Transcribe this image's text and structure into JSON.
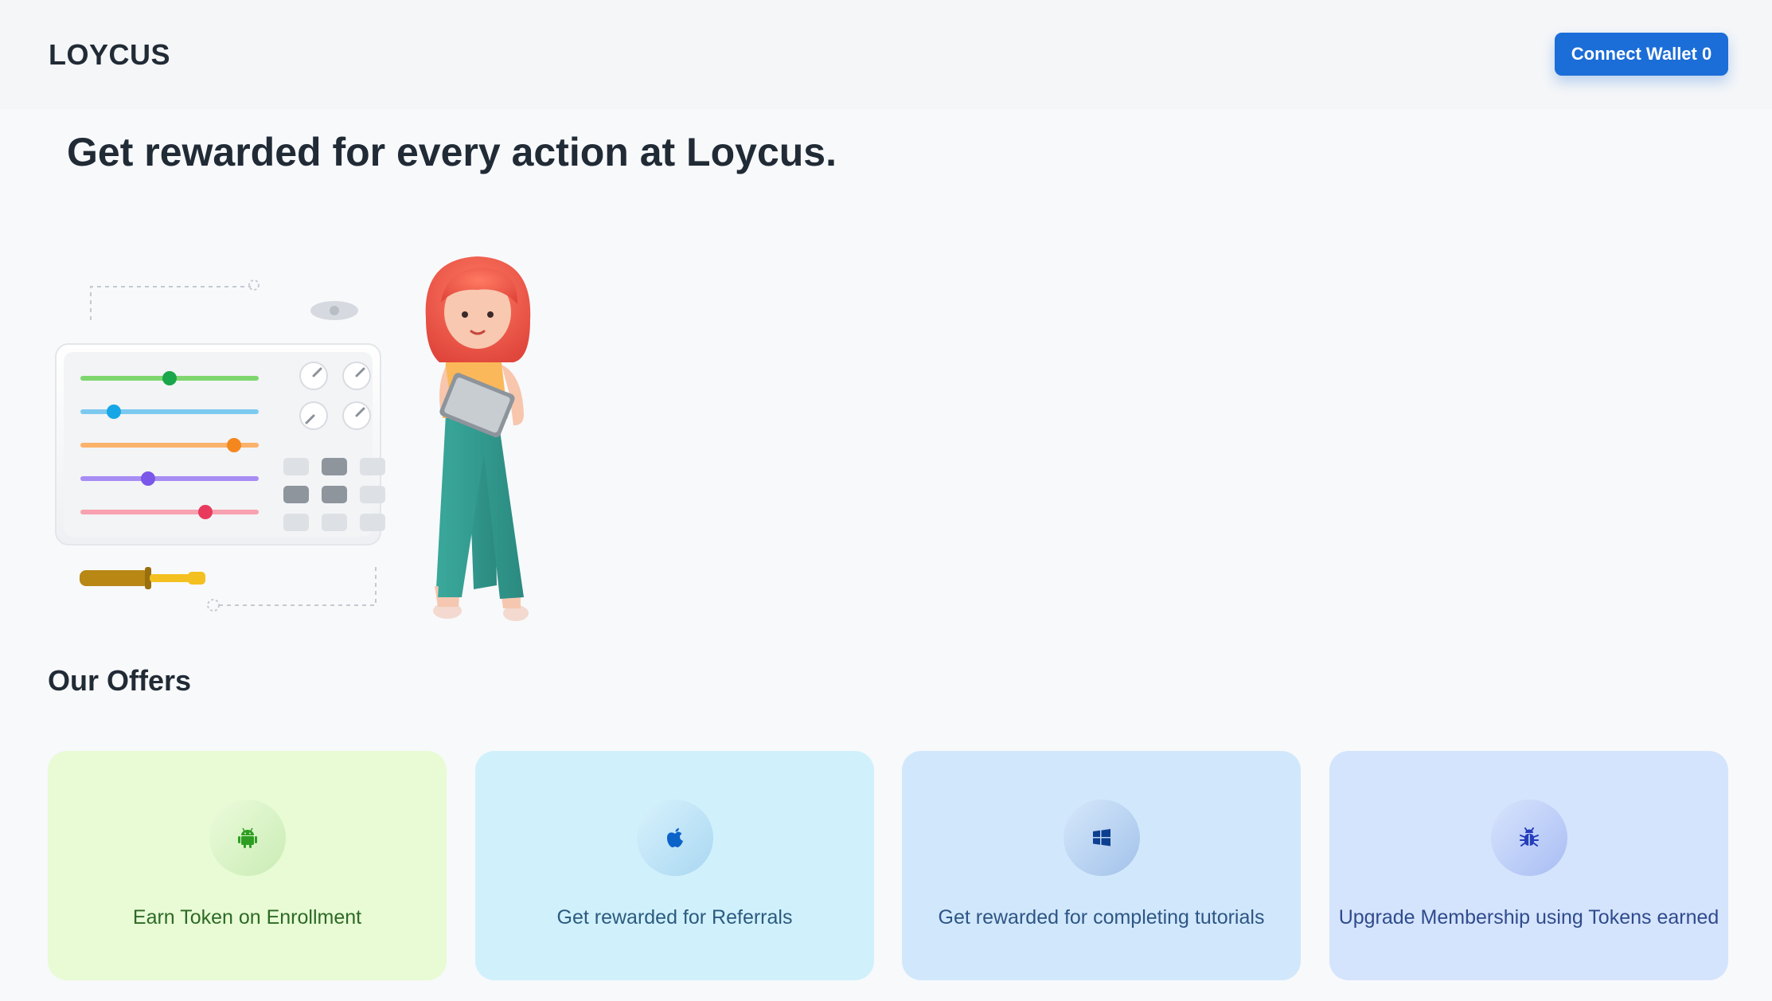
{
  "header": {
    "logo": "LOYCUS",
    "connect_button": "Connect Wallet 0"
  },
  "hero": {
    "title": "Get rewarded for every action at Loycus."
  },
  "offers": {
    "title": "Our Offers",
    "cards": [
      {
        "label": "Earn Token on Enrollment",
        "icon": "android-icon",
        "color": "#2e9e22"
      },
      {
        "label": "Get rewarded for Referrals",
        "icon": "apple-icon",
        "color": "#0b63c9"
      },
      {
        "label": "Get rewarded for completing tutorials",
        "icon": "windows-icon",
        "color": "#0c3f8f"
      },
      {
        "label": "Upgrade Membership using Tokens earned",
        "icon": "bug-icon",
        "color": "#243dba"
      }
    ]
  },
  "colors": {
    "accent": "#1b6dd8"
  }
}
